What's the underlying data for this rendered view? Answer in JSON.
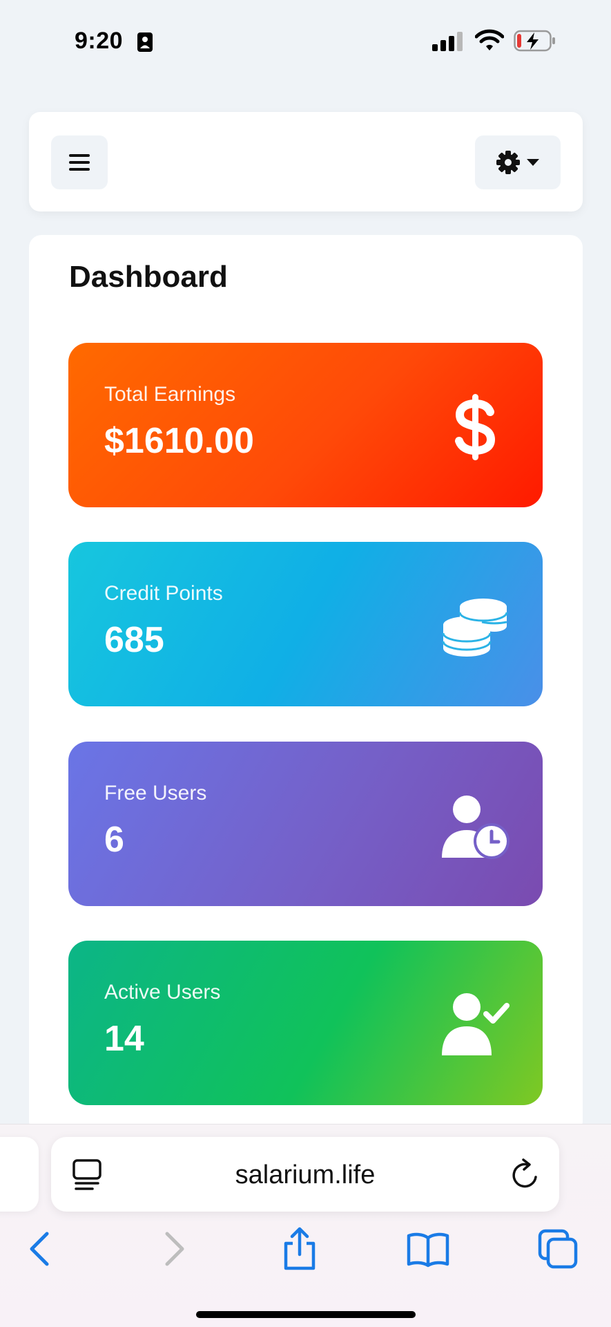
{
  "status_bar": {
    "time": "9:20"
  },
  "header": {
    "menu_icon": "hamburger-icon",
    "settings_icon": "gear-icon",
    "settings_caret": "caret-down-icon"
  },
  "dashboard": {
    "title": "Dashboard",
    "cards": [
      {
        "label": "Total Earnings",
        "value": "$1610.00",
        "icon": "dollar-icon",
        "colors": [
          "#ff6a00",
          "#ff1a00"
        ]
      },
      {
        "label": "Credit Points",
        "value": "685",
        "icon": "coins-icon",
        "colors": [
          "#17c6de",
          "#4a8fe8"
        ]
      },
      {
        "label": "Free Users",
        "value": "6",
        "icon": "user-clock-icon",
        "colors": [
          "#6a75e6",
          "#7a4bb0"
        ]
      },
      {
        "label": "Active Users",
        "value": "14",
        "icon": "user-check-icon",
        "colors": [
          "#0cb587",
          "#7fc823"
        ]
      }
    ]
  },
  "browser": {
    "url": "salarium.life",
    "accent": "#1a7be6",
    "toolbar": [
      "back-icon",
      "forward-icon",
      "share-icon",
      "bookmarks-icon",
      "tabs-icon"
    ]
  }
}
